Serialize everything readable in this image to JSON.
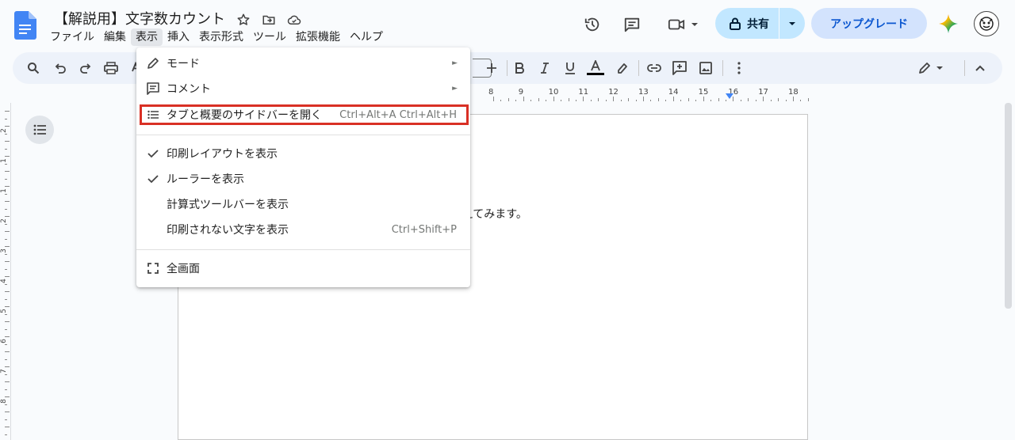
{
  "header": {
    "title": "【解説用】文字数カウント",
    "menus": [
      "ファイル",
      "編集",
      "表示",
      "挿入",
      "表示形式",
      "ツール",
      "拡張機能",
      "ヘルプ"
    ],
    "active_menu_index": 2,
    "share_label": "共有",
    "upgrade_label": "アップグレード"
  },
  "toolbar": {
    "icons": [
      "search-icon",
      "undo-icon",
      "redo-icon",
      "print-icon",
      "spellcheck-icon",
      "increase-font-icon",
      "bold-icon",
      "italic-icon",
      "underline-icon",
      "text-color-icon",
      "highlight-icon",
      "link-icon",
      "add-comment-icon",
      "insert-image-icon",
      "more-icon",
      "edit-mode-icon",
      "collapse-icon"
    ]
  },
  "ruler": {
    "numbers": [
      "8",
      "9",
      "10",
      "11",
      "12",
      "13",
      "14",
      "15",
      "16",
      "17",
      "18"
    ],
    "v_numbers": [
      "2",
      "1",
      "1",
      "2",
      "3",
      "4",
      "5",
      "6",
      "7",
      "8"
    ]
  },
  "document": {
    "visible_text": "えてみます。"
  },
  "view_menu": {
    "items": [
      {
        "label": "モード",
        "icon": "pencil-icon",
        "submenu": true
      },
      {
        "label": "コメント",
        "icon": "comment-icon",
        "submenu": true
      },
      {
        "label": "タブと概要のサイドバーを開く",
        "icon": "list-icon",
        "shortcut": "Ctrl+Alt+A Ctrl+Alt+H",
        "highlighted": true
      },
      {
        "label": "印刷レイアウトを表示",
        "checked": true
      },
      {
        "label": "ルーラーを表示",
        "checked": true
      },
      {
        "label": "計算式ツールバーを表示"
      },
      {
        "label": "印刷されない文字を表示",
        "shortcut": "Ctrl+Shift+P"
      },
      {
        "label": "全画面",
        "icon": "fullscreen-icon"
      }
    ],
    "submenu_arrow": "►"
  },
  "colors": {
    "accent": "#0b57d0",
    "share_bg": "#c2e7ff",
    "upgrade_bg": "#d3e3fd",
    "highlight_border": "#d93025",
    "toolbar_bg": "#edf2fa"
  }
}
